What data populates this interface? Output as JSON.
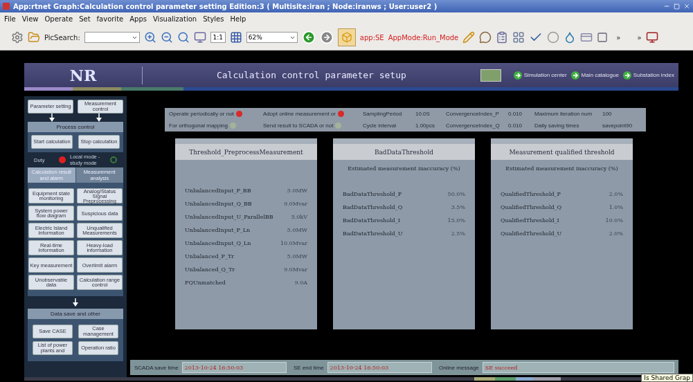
{
  "window": {
    "title": "App:rtnet  Graph:Calculation control parameter setting  Edition:3 ( Multisite:iran  ;  Node:iranws  ;  User:user2 )"
  },
  "menu": [
    "File",
    "View",
    "Operate",
    "Set",
    "favorite",
    "Apps",
    "Visualization",
    "Styles",
    "Help"
  ],
  "toolbar": {
    "search_label": "PicSearch:",
    "zoom_ratio": "1:1",
    "zoom_value": "62%",
    "app": "app:SE",
    "app_mode": "AppMode:Run_Mode",
    "more": [
      "»",
      "»"
    ]
  },
  "header": {
    "logo": "NR",
    "title": "Calculation control parameter setup",
    "links": [
      "Simulation center",
      "Main catalogue",
      "Substation index"
    ]
  },
  "left_panel": {
    "top_buttons": [
      "Parameter setting",
      "Measurement control"
    ],
    "process": {
      "title": "Process control",
      "buttons": [
        "Start calculation",
        "Stop calculation"
      ]
    },
    "duty": {
      "label": "Duty",
      "on": true
    },
    "mode": {
      "label": "Local mode - study mode",
      "on": false
    },
    "tabs": [
      {
        "label": "Calculation result and alarm",
        "selected": true
      },
      {
        "label": "Measurement analysis",
        "selected": false
      }
    ],
    "buttons": [
      "Equipment state monitoring",
      "Analog/Status Signal Preprocessing",
      "System power flow diagram",
      "Suspicious data",
      "Electric Island Information",
      "Unqualified Measurements",
      "Real-time Information",
      "Heavy-load information",
      "Key measurement",
      "Overlimit alarm",
      "Unobservable data",
      "Calculation range control"
    ],
    "save": {
      "title": "Data save and other",
      "buttons": [
        "Save CASE",
        "Case management",
        "List of power plants and",
        "Operation ratio"
      ]
    }
  },
  "params": {
    "switches": [
      {
        "label": "Operate periodically or not",
        "on": true
      },
      {
        "label": "Adopt online measurement or",
        "on": true
      },
      {
        "label": "For orthogonal mapping",
        "on": false
      },
      {
        "label": "Send result to SCADA or not",
        "on": false
      }
    ],
    "values": [
      {
        "label": "SamplingPeriod",
        "value": "10.0S"
      },
      {
        "label": "ConvergenceIndex_P",
        "value": "0.010"
      },
      {
        "label": "Maximum iteration num",
        "value": "100"
      },
      {
        "label": "Cycle interval",
        "value": "1.00pcs"
      },
      {
        "label": "ConvergenceIndex_Q",
        "value": "0.010"
      },
      {
        "label": "Daily saving times",
        "value": "savepoint90"
      }
    ]
  },
  "panels": [
    {
      "title": "Threshold_PreprocessMeasurement",
      "rows": [
        {
          "name": "UnbalancedInput_P_BB",
          "value": "5.0MW"
        },
        {
          "name": "UnbalancedInput_Q_BB",
          "value": "9.0Mvar"
        },
        {
          "name": "UnbalancedInput_U_ParallelBB",
          "value": "5.0kV"
        },
        {
          "name": "UnbalancedInput_P_Ln",
          "value": "5.0MW"
        },
        {
          "name": "UnbalancedInput_Q_Ln",
          "value": "10.0Mvar"
        },
        {
          "name": "Unbalanced_P_Tr",
          "value": "5.0MW"
        },
        {
          "name": "Unbalanced_Q_Tr",
          "value": "9.0Mvar"
        },
        {
          "name": "PQUnmatched",
          "value": "9.0A"
        }
      ]
    },
    {
      "title": "BadDataThreshold",
      "subtitle": "Estimated measurement inaccuracy (%)",
      "rows": [
        {
          "name": "BadDataThreshold_P",
          "value": "50.0%"
        },
        {
          "name": "BadDataThreshold_Q",
          "value": "3.5%"
        },
        {
          "name": "BadDataThreshold_I",
          "value": "15.0%"
        },
        {
          "name": "BadDataThreshold_U",
          "value": "2.5%"
        }
      ]
    },
    {
      "title": "Measurement qualified threshold",
      "subtitle": "Estimated measurement inaccuracy (%)",
      "rows": [
        {
          "name": "QualifiedThreshold_P",
          "value": "2.0%"
        },
        {
          "name": "QualifiedThreshold_Q",
          "value": "1.0%"
        },
        {
          "name": "QualifiedThreshold_I",
          "value": "10.0%"
        },
        {
          "name": "QualifiedThreshold_U",
          "value": "2.0%"
        }
      ]
    }
  ],
  "status": [
    {
      "label": "SCADA save time",
      "value": "2013-10-24 16:50:03"
    },
    {
      "label": "SE end time",
      "value": "2013-10-24 16:50:03"
    },
    {
      "label": "Online message",
      "value": "SE succeed"
    }
  ],
  "tooltip": "Is Shared Grap"
}
